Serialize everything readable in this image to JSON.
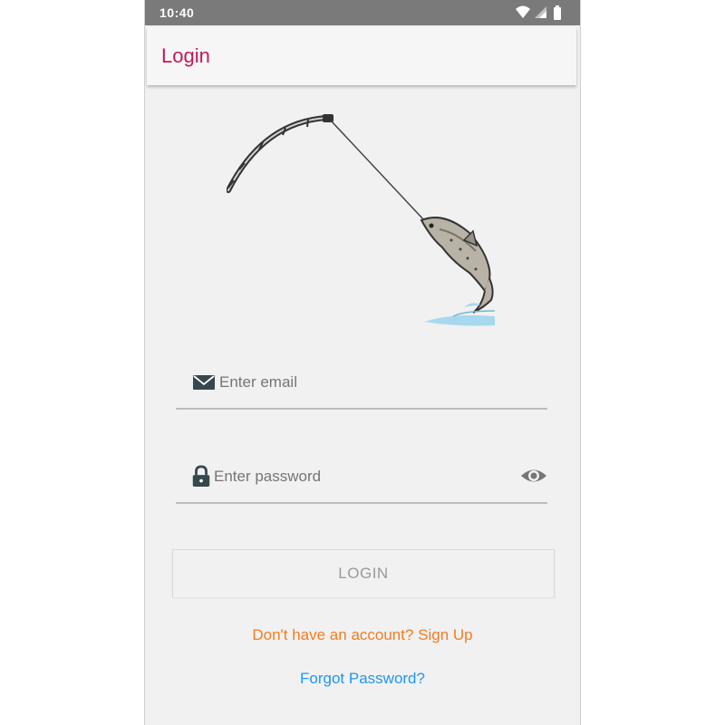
{
  "status_bar": {
    "time": "10:40",
    "icons": [
      "wifi-icon",
      "signal-icon",
      "battery-icon"
    ]
  },
  "app_bar": {
    "title": "Login"
  },
  "illustration": {
    "name": "fishing-rod-with-jumping-fish"
  },
  "form": {
    "email": {
      "icon": "envelope-icon",
      "placeholder": "Enter email",
      "value": ""
    },
    "password": {
      "icon": "lock-icon",
      "placeholder": "Enter password",
      "value": "",
      "toggle_icon": "eye-icon"
    },
    "login_label": "LOGIN"
  },
  "links": {
    "signup": "Don't have an account? Sign Up",
    "forgot": "Forgot Password?"
  },
  "colors": {
    "title": "#c2185b",
    "status_bar": "#7a7a7a",
    "signup_link": "#f47b20",
    "forgot_link": "#2196f3",
    "background": "#f1f1f1"
  }
}
